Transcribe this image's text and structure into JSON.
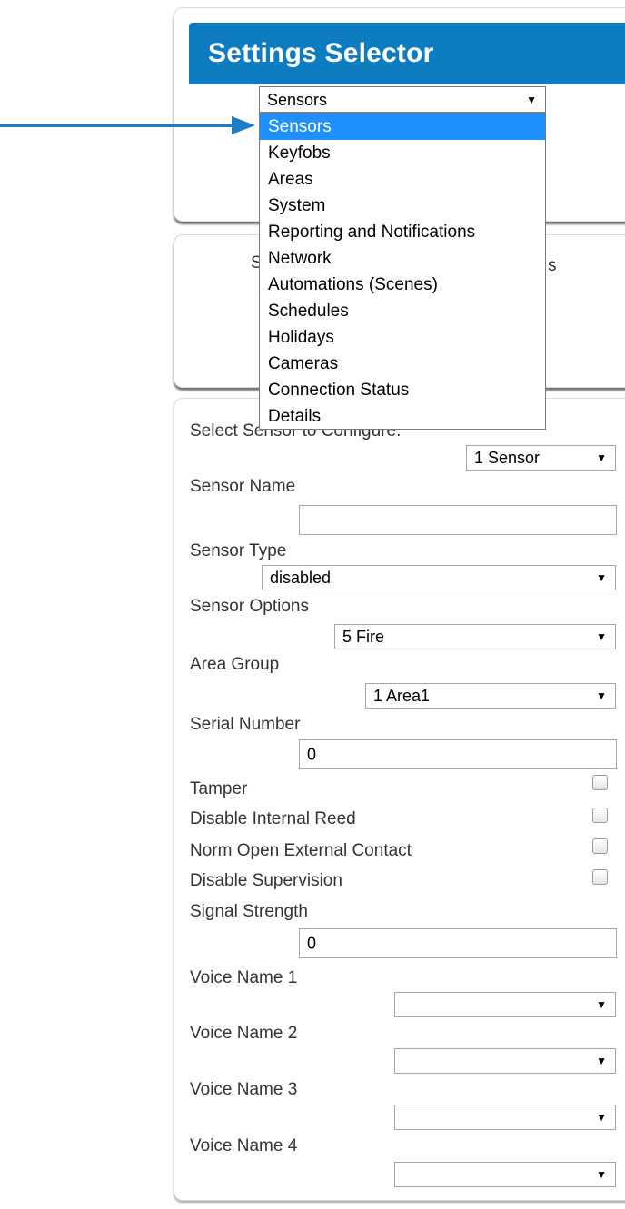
{
  "header": {
    "title": "Settings Selector"
  },
  "settings_select": {
    "value": "Sensors",
    "options": [
      "Sensors",
      "Keyfobs",
      "Areas",
      "System",
      "Reporting and Notifications",
      "Network",
      "Automations (Scenes)",
      "Schedules",
      "Holidays",
      "Cameras",
      "Connection Status",
      "Details"
    ],
    "highlighted_index": 0
  },
  "panel2": {
    "peek_left": "S",
    "peek_right": "s"
  },
  "form": {
    "select_sensor": {
      "label": "Select Sensor to Configure:",
      "value": "1 Sensor"
    },
    "sensor_name": {
      "label": "Sensor Name",
      "value": ""
    },
    "sensor_type": {
      "label": "Sensor Type",
      "value": "disabled"
    },
    "sensor_options": {
      "label": "Sensor Options",
      "value": "5 Fire"
    },
    "area_group": {
      "label": "Area Group",
      "value": "1 Area1"
    },
    "serial_number": {
      "label": "Serial Number",
      "value": "0"
    },
    "tamper": {
      "label": "Tamper",
      "checked": false
    },
    "disable_internal_reed": {
      "label": "Disable Internal Reed",
      "checked": false
    },
    "norm_open_external_contact": {
      "label": "Norm Open External Contact",
      "checked": false
    },
    "disable_supervision": {
      "label": "Disable Supervision",
      "checked": false
    },
    "signal_strength": {
      "label": "Signal Strength",
      "value": "0"
    },
    "voice_name_1": {
      "label": "Voice Name 1",
      "value": ""
    },
    "voice_name_2": {
      "label": "Voice Name 2",
      "value": ""
    },
    "voice_name_3": {
      "label": "Voice Name 3",
      "value": ""
    },
    "voice_name_4": {
      "label": "Voice Name 4",
      "value": ""
    }
  },
  "colors": {
    "header_bg": "#0e7cc1",
    "highlight": "#1e90ff",
    "arrow": "#1a7ec8"
  },
  "icons": {
    "select_caret": "caret-down-icon",
    "pointer": "arrow-right-icon"
  }
}
